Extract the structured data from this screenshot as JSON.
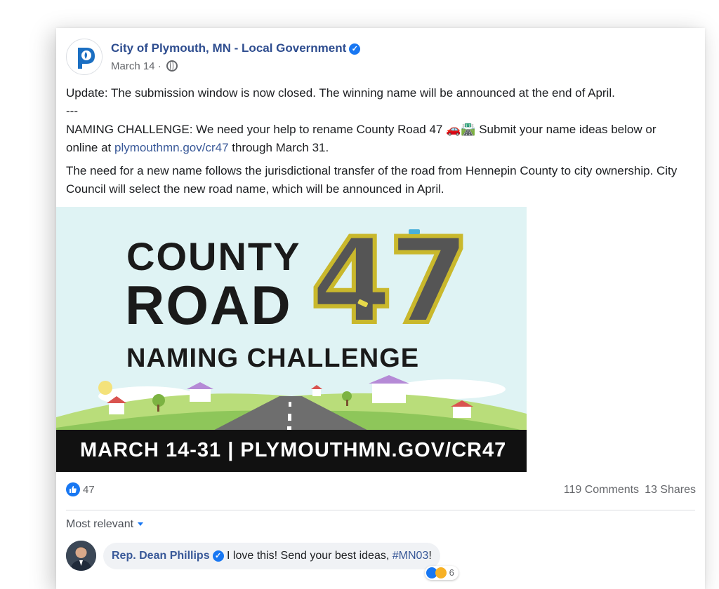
{
  "post": {
    "page_name": "City of Plymouth, MN - Local Government",
    "date": "March 14",
    "separator": " · ",
    "update_text": "Update: The submission window is now closed. The winning name will be announced at the end of April.",
    "dashes": "---",
    "challenge_text_1": "NAMING CHALLENGE: We need your help to rename County Road 47 ",
    "challenge_emojis": "🚗🛣️",
    "challenge_text_2": " Submit your name ideas below or online at ",
    "link_text": "plymouthmn.gov/cr47",
    "challenge_text_3": " through March 31.",
    "paragraph_2": "The need for a new name follows the jurisdictional transfer of the road from Hennepin County to city ownership. City Council will select the new road name, which will be announced in April."
  },
  "banner": {
    "line1": "COUNTY",
    "line2": "ROAD",
    "number": "47",
    "line3": "NAMING CHALLENGE",
    "footer": "MARCH 14-31 | PLYMOUTHMN.GOV/CR47"
  },
  "engagement": {
    "like_count": "47",
    "comments": "119 Comments",
    "shares": "13 Shares"
  },
  "comments_section": {
    "sort_label": "Most relevant",
    "comment": {
      "author": "Rep. Dean Phillips",
      "text": " I love this! Send your best ideas, ",
      "hashtag": "#MN03",
      "text_end": "!",
      "reaction_count": "6"
    }
  },
  "colors": {
    "link": "#385898",
    "page_name": "#2e4d8f",
    "facebook_blue": "#1877f2",
    "banner_bg": "#dff3f4",
    "road_yellow": "#c9b82c"
  },
  "icons": [
    "plymouth-logo-icon",
    "verified-badge-icon",
    "globe-icon",
    "like-icon",
    "haha-icon",
    "chevron-down-icon"
  ]
}
